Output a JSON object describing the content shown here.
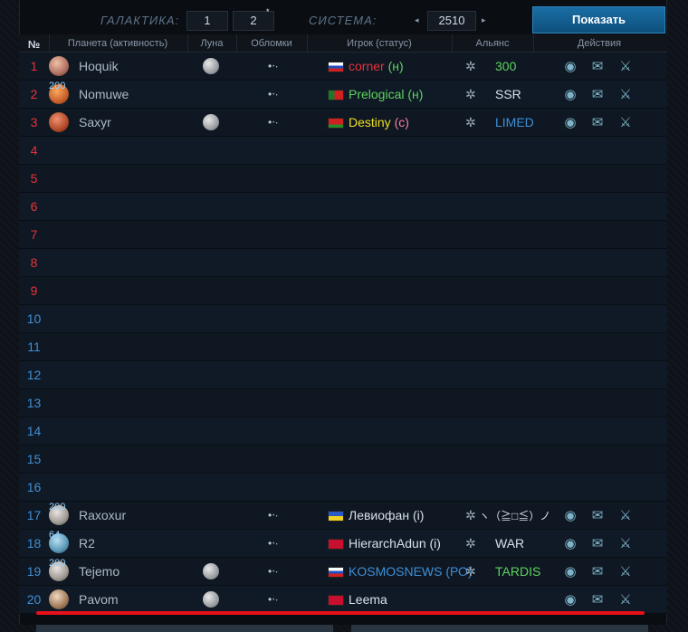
{
  "header": {
    "galaxy_label": "ГАЛАКТИКА:",
    "galaxy_value": "1",
    "galaxy_value2": "2",
    "star": "*",
    "system_label": "СИСТЕМА:",
    "system_value": "2510",
    "arrow_left": "◂",
    "arrow_right": "▸",
    "show_button": "Показать"
  },
  "columns": {
    "num": "№",
    "planet": "Планета (активность)",
    "moon": "Луна",
    "debris": "Обломки",
    "player": "Игрок (статус)",
    "alliance": "Альянс",
    "actions": "Действия"
  },
  "colors": {
    "accent": "#1a6ea5",
    "red": "#e8101a",
    "num_red": "#e8323a",
    "num_blue": "#3f8fd6",
    "green": "#5ed35e",
    "yellow": "#f0e020",
    "pink": "#ff7fa0"
  },
  "rows": [
    {
      "num": "1",
      "planet": "Hoquik",
      "activity": "",
      "moon": true,
      "debris": true,
      "player": "corner",
      "status": "(н)",
      "alliance": "300",
      "planet_kind": "ringed"
    },
    {
      "num": "2",
      "planet": "Nomuwe",
      "activity": "200",
      "moon": false,
      "debris": true,
      "player": "Prelogical",
      "status": "(н)",
      "alliance": "SSR",
      "planet_kind": "orange"
    },
    {
      "num": "3",
      "planet": "Saxyr",
      "activity": "",
      "moon": true,
      "debris": true,
      "player": "Destiny",
      "status": "(с)",
      "alliance": "LIMED",
      "planet_kind": "red"
    },
    {
      "num": "4"
    },
    {
      "num": "5"
    },
    {
      "num": "6"
    },
    {
      "num": "7"
    },
    {
      "num": "8"
    },
    {
      "num": "9"
    },
    {
      "num": "10"
    },
    {
      "num": "11"
    },
    {
      "num": "12"
    },
    {
      "num": "13"
    },
    {
      "num": "14"
    },
    {
      "num": "15"
    },
    {
      "num": "16"
    },
    {
      "num": "17",
      "planet": "Raxoxur",
      "activity": "200",
      "moon": false,
      "debris": true,
      "player": "Левиофан",
      "status": "(i)",
      "alliance": "ヽ（≧□≦）ノ",
      "planet_kind": "gray"
    },
    {
      "num": "18",
      "planet": "R2",
      "activity": "64",
      "moon": false,
      "debris": true,
      "player": "HierarchAdun",
      "status": "(i)",
      "alliance": "WAR",
      "planet_kind": "blue"
    },
    {
      "num": "19",
      "planet": "Tejemo",
      "activity": "200",
      "moon": true,
      "debris": true,
      "player": "KOSMOSNEWS",
      "status": "(РО)",
      "alliance": "TARDIS",
      "planet_kind": "gray"
    },
    {
      "num": "20",
      "planet": "Pavom",
      "activity": "",
      "moon": true,
      "debris": true,
      "player": "Leema",
      "status": "",
      "alliance": "",
      "planet_kind": "brown"
    }
  ],
  "icons": {
    "view": "eye-icon",
    "message": "envelope-icon",
    "buddy": "handshake-icon",
    "debris": "debris-icon",
    "alliance": "alliance-emblem-icon"
  }
}
